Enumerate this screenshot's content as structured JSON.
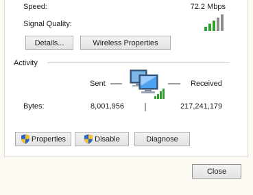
{
  "details": {
    "speed_label": "Speed:",
    "speed_value": "72.2 Mbps",
    "signal_label": "Signal Quality:",
    "signal_bars_lit": 3,
    "signal_bars_total": 5
  },
  "buttons": {
    "details_label": "Details...",
    "wireless_properties_label": "Wireless Properties"
  },
  "activity": {
    "heading": "Activity",
    "sent_label": "Sent",
    "received_label": "Received",
    "bytes_label": "Bytes:",
    "bytes_sent": "8,001,956",
    "bytes_received": "217,241,179"
  },
  "actions": {
    "properties_label": "Properties",
    "disable_label": "Disable",
    "diagnose_label": "Diagnose"
  },
  "footer": {
    "close_label": "Close"
  },
  "colors": {
    "signal_lit": "#2f9e2f",
    "signal_unlit": "#8c8c8c",
    "shield_blue": "#2a62c9",
    "shield_yellow": "#f2c12e"
  }
}
